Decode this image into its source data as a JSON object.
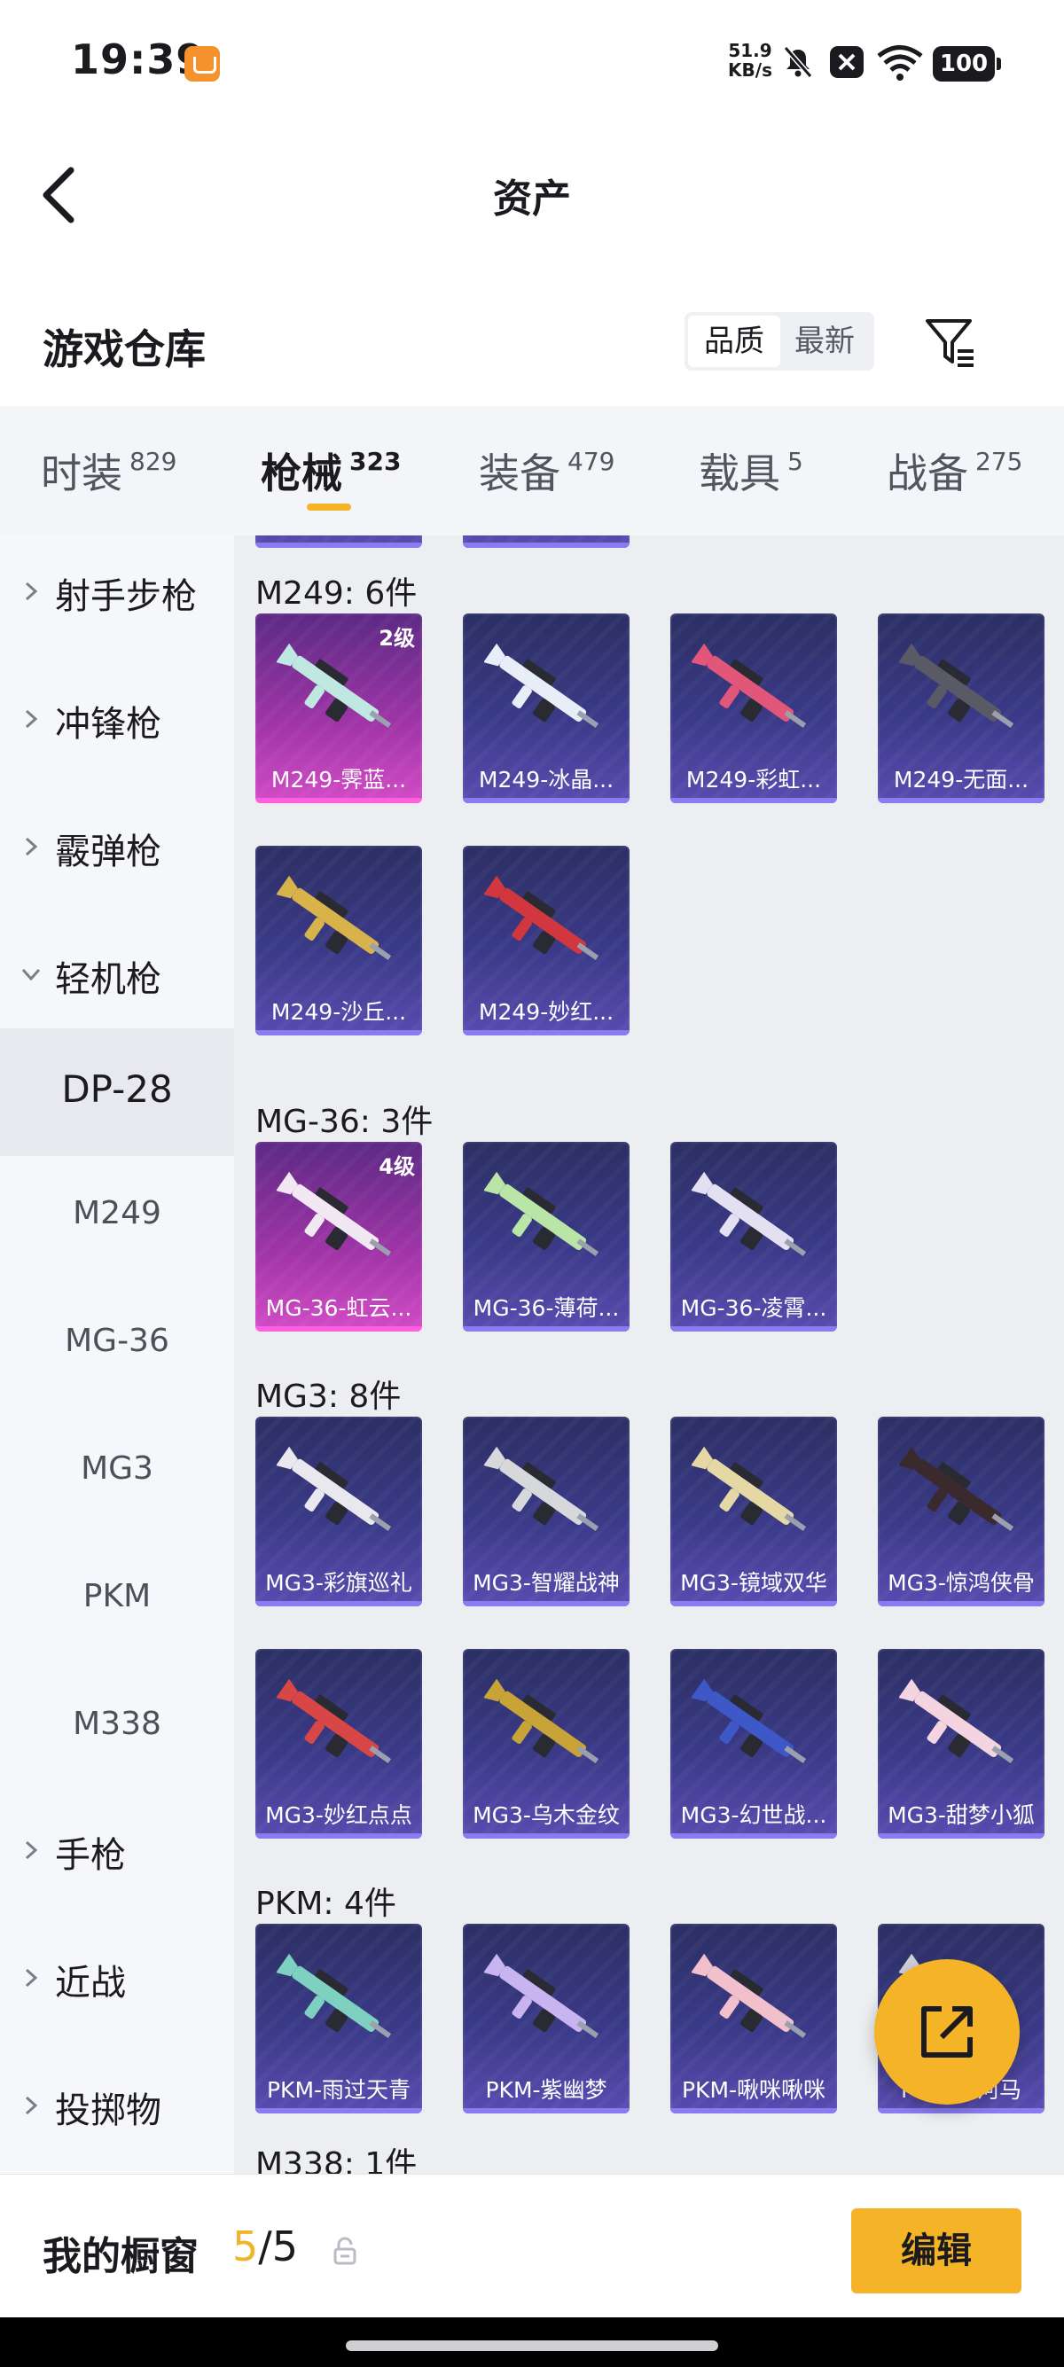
{
  "status_bar": {
    "time": "19:39",
    "net_speed_value": "51.9",
    "net_speed_unit": "KB/s",
    "battery": "100"
  },
  "header": {
    "title": "资产"
  },
  "warehouse": {
    "title": "游戏仓库",
    "sort_quality": "品质",
    "sort_newest": "最新"
  },
  "tabs": [
    {
      "label": "时装",
      "count": "829"
    },
    {
      "label": "枪械",
      "count": "323"
    },
    {
      "label": "装备",
      "count": "479"
    },
    {
      "label": "载具",
      "count": "5"
    },
    {
      "label": "战备",
      "count": "275"
    }
  ],
  "sidebar": {
    "items": [
      {
        "label": "射手步枪"
      },
      {
        "label": "冲锋枪"
      },
      {
        "label": "霰弹枪"
      },
      {
        "label": "轻机枪"
      },
      {
        "label": "DP-28"
      },
      {
        "label": "M249"
      },
      {
        "label": "MG-36"
      },
      {
        "label": "MG3"
      },
      {
        "label": "PKM"
      },
      {
        "label": "M338"
      },
      {
        "label": "手枪"
      },
      {
        "label": "近战"
      },
      {
        "label": "投掷物"
      }
    ]
  },
  "groups": [
    {
      "title": "M249: 6件",
      "items": [
        {
          "name": "M249-霁蓝...",
          "level": "2级",
          "accent": "#bfe8e0"
        },
        {
          "name": "M249-冰晶...",
          "level": "",
          "accent": "#e8eef8"
        },
        {
          "name": "M249-彩虹...",
          "level": "",
          "accent": "#e2567a"
        },
        {
          "name": "M249-无面...",
          "level": "",
          "accent": "#5a5a66"
        },
        {
          "name": "M249-沙丘...",
          "level": "",
          "accent": "#d8b24a"
        },
        {
          "name": "M249-妙红...",
          "level": "",
          "accent": "#d2363e"
        }
      ]
    },
    {
      "title": "MG-36: 3件",
      "items": [
        {
          "name": "MG-36-虹云...",
          "level": "4级",
          "accent": "#f2e8f4"
        },
        {
          "name": "MG-36-薄荷...",
          "level": "",
          "accent": "#b9e6a6"
        },
        {
          "name": "MG-36-凌霄...",
          "level": "",
          "accent": "#e4e0f2"
        }
      ]
    },
    {
      "title": "MG3: 8件",
      "items": [
        {
          "name": "MG3-彩旗巡礼",
          "level": "",
          "accent": "#e8e8ee"
        },
        {
          "name": "MG3-智耀战神",
          "level": "",
          "accent": "#d6d8dc"
        },
        {
          "name": "MG3-镜域双华",
          "level": "",
          "accent": "#e6d8a4"
        },
        {
          "name": "MG3-惊鸿侠骨",
          "level": "",
          "accent": "#3a2a2e"
        },
        {
          "name": "MG3-妙红点点",
          "level": "",
          "accent": "#d84646"
        },
        {
          "name": "MG3-乌木金纹",
          "level": "",
          "accent": "#c8a438"
        },
        {
          "name": "MG3-幻世战...",
          "level": "",
          "accent": "#3e58c8"
        },
        {
          "name": "MG3-甜梦小狐",
          "level": "",
          "accent": "#f4d4e0"
        }
      ]
    },
    {
      "title": "PKM: 4件",
      "items": [
        {
          "name": "PKM-雨过天青",
          "level": "",
          "accent": "#7ed0c0"
        },
        {
          "name": "PKM-紫幽梦",
          "level": "",
          "accent": "#c8b4f0"
        },
        {
          "name": "PKM-啾咪啾咪",
          "level": "",
          "accent": "#f2c0cc"
        },
        {
          "name": "PKM-...河马",
          "level": "",
          "accent": "#d0d0d8"
        }
      ]
    },
    {
      "title": "M338: 1件",
      "items": []
    }
  ],
  "showcase": {
    "label": "我的橱窗",
    "current": "5",
    "total": "/5",
    "edit_label": "编辑"
  },
  "colors": {
    "accent": "#f5b427",
    "rare_card": "#b23cb0",
    "normal_card": "#3a3a88"
  }
}
